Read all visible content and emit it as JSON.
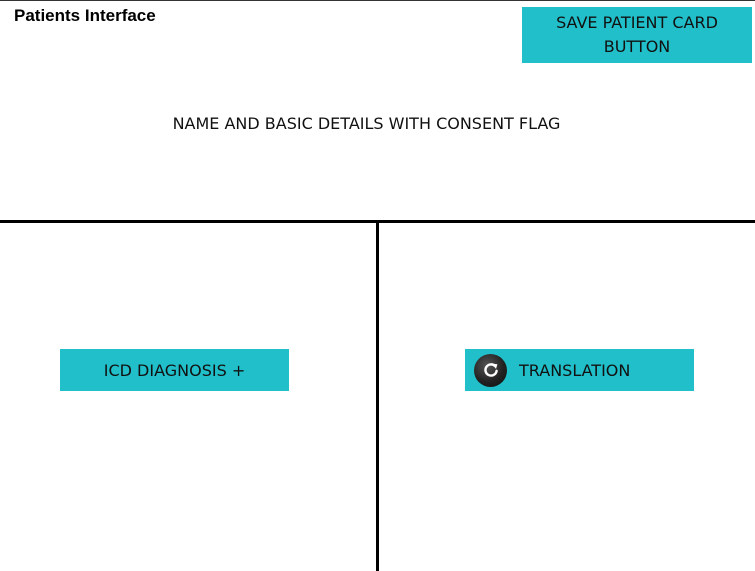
{
  "header": {
    "title": "Patients Interface",
    "save_button_label": "SAVE PATIENT CARD BUTTON"
  },
  "details": {
    "text": "NAME AND BASIC DETAILS WITH CONSENT FLAG"
  },
  "left_panel": {
    "icd_button_label": "ICD DIAGNOSIS +"
  },
  "right_panel": {
    "translation_button_label": "TRANSLATION",
    "translation_icon": "refresh-icon"
  },
  "colors": {
    "accent": "#20bfc9",
    "divider": "#000000",
    "background": "#ffffff"
  }
}
